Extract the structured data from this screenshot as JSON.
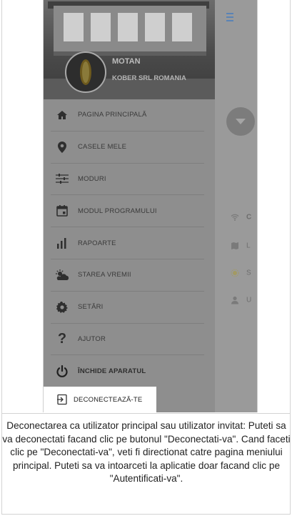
{
  "app": {
    "brand": "MOTAN",
    "company": "KOBER SRL ROMANIA"
  },
  "menu": {
    "items": [
      {
        "label": "PAGINA PRINCIPALĂ",
        "icon": "home-icon"
      },
      {
        "label": "CASELE MELE",
        "icon": "location-pin-icon"
      },
      {
        "label": "MODURI",
        "icon": "sliders-icon"
      },
      {
        "label": "MODUL PROGRAMULUI",
        "icon": "calendar-icon"
      },
      {
        "label": "RAPOARTE",
        "icon": "bar-chart-icon"
      },
      {
        "label": "STAREA VREMII",
        "icon": "weather-icon"
      },
      {
        "label": "SETĂRI",
        "icon": "gear-icon"
      },
      {
        "label": "AJUTOR",
        "icon": "question-mark-icon"
      },
      {
        "label": "ÎNCHIDE APARATUL",
        "icon": "power-icon"
      }
    ],
    "logout": {
      "label": "DECONECTEAZĂ-TE",
      "icon": "logout-icon"
    }
  },
  "background": {
    "rows": [
      {
        "text": "C",
        "icon": "wifi-icon"
      },
      {
        "text": "L",
        "icon": "map-icon"
      },
      {
        "text": "S",
        "icon": "sun-icon"
      },
      {
        "text": "U",
        "icon": "user-icon"
      }
    ]
  },
  "caption": "Deconectarea ca utilizator principal sau utilizator invitat: Puteti sa va deconectati facand clic pe butonul \"Deconectati-va\". Cand faceti clic pe \"Deconectati-va\", veti fi directionat catre pagina meniului principal. Puteti sa va intoarceti la aplicatie doar facand clic pe \"Autentificati-va\".",
  "colors": {
    "overlay": "#8e8e8e",
    "menu_text": "#3a3a3a",
    "logout_bg": "#ffffff"
  }
}
